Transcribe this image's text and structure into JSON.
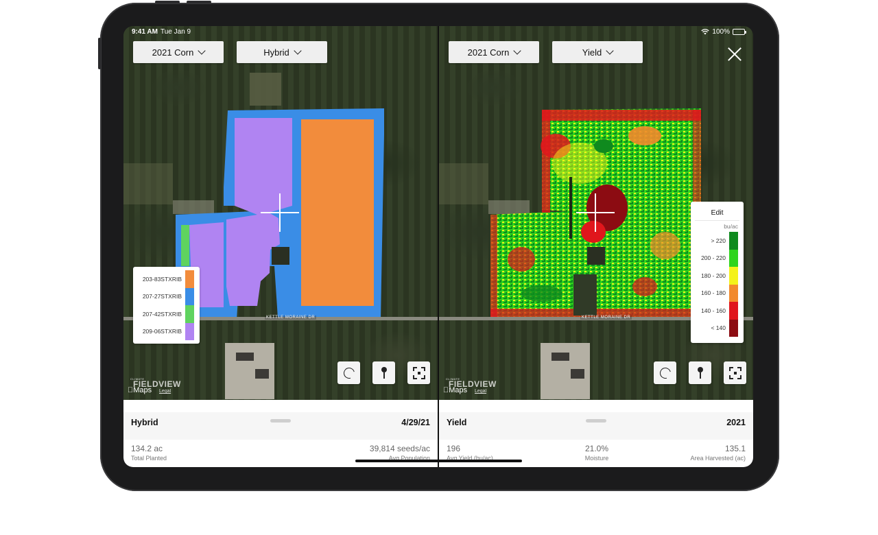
{
  "status_bar": {
    "time": "9:41 AM",
    "date": "Tue Jan 9",
    "battery": "100%"
  },
  "left_pane": {
    "season_dropdown": "2021 Corn",
    "layer_dropdown": "Hybrid",
    "road_label": "KETTLE MORAINE DR",
    "legend": [
      {
        "label": "203-83STXRIB",
        "color": "#f28c3c"
      },
      {
        "label": "207-27STXRIB",
        "color": "#3a8de6"
      },
      {
        "label": "207-42STXRIB",
        "color": "#5fd35f"
      },
      {
        "label": "209-06STXRIB",
        "color": "#b084f2"
      }
    ],
    "panel": {
      "title": "Hybrid",
      "date": "4/29/21",
      "stats": [
        {
          "value": "134.2 ac",
          "label": "Total Planted"
        },
        {
          "value": "39,814 seeds/ac",
          "label": "Avg Population"
        }
      ]
    }
  },
  "right_pane": {
    "season_dropdown": "2021 Corn",
    "layer_dropdown": "Yield",
    "road_label": "KETTLE MORAINE DR",
    "legend_edit": "Edit",
    "legend_unit": "bu/ac",
    "legend": [
      {
        "label": "> 220",
        "color": "#0f8a1e"
      },
      {
        "label": "200 - 220",
        "color": "#2fd41c"
      },
      {
        "label": "180 - 200",
        "color": "#f4f21a"
      },
      {
        "label": "160 - 180",
        "color": "#f28a2c"
      },
      {
        "label": "140 - 160",
        "color": "#e0161c"
      },
      {
        "label": "< 140",
        "color": "#8c0c12"
      }
    ],
    "panel": {
      "title": "Yield",
      "year": "2021",
      "stats": [
        {
          "value": "196",
          "label": "Avg Yield (bu/ac)"
        },
        {
          "value": "21.0%",
          "label": "Moisture"
        },
        {
          "value": "135.1",
          "label": "Area Harvested (ac)"
        }
      ]
    }
  },
  "map_watermark": {
    "climate": "CLIMATE",
    "brand": "FIELDVIEW",
    "maps": "Maps",
    "legal": "Legal"
  },
  "icons": [
    "lasso-icon",
    "pin-icon",
    "recenter-icon",
    "close-icon",
    "chevron-down-icon",
    "wifi-icon",
    "battery-icon"
  ]
}
